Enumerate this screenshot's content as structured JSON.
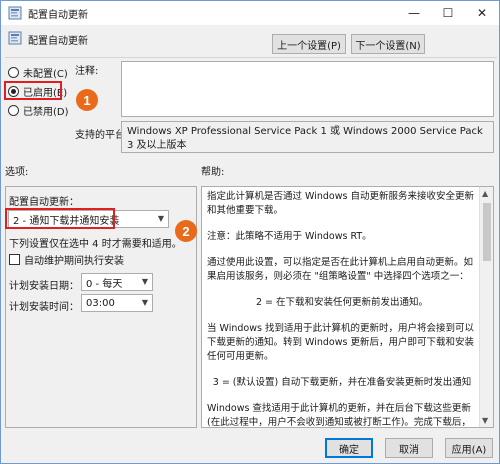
{
  "window": {
    "title": "配置自动更新",
    "minimize": "—",
    "maximize": "☐",
    "close": "✕"
  },
  "header": {
    "title": "配置自动更新",
    "prev_button": "上一个设置(P)",
    "next_button": "下一个设置(N)"
  },
  "state": {
    "options": [
      {
        "label": "未配置(C)",
        "selected": false
      },
      {
        "label": "已启用(E)",
        "selected": true
      },
      {
        "label": "已禁用(D)",
        "selected": false
      }
    ]
  },
  "comment": {
    "label": "注释:",
    "value": ""
  },
  "platform": {
    "label": "支持的平台:",
    "value": "Windows XP Professional Service Pack 1 或 Windows 2000 Service Pack 3 及以上版本"
  },
  "sections": {
    "options_label": "选项:",
    "help_label": "帮助:"
  },
  "options_panel": {
    "title": "配置自动更新：",
    "mode_value": "2 - 通知下载并通知安装",
    "note": "下列设置仅在选中 4 时才需要和适用。",
    "maintenance_checkbox": "自动维护期间执行安装",
    "maintenance_checked": false,
    "schedule_day_label": "计划安装日期：",
    "schedule_day_value": "0 - 每天",
    "schedule_time_label": "计划安装时间：",
    "schedule_time_value": "03:00"
  },
  "help": {
    "paragraphs": [
      "指定此计算机是否通过 Windows 自动更新服务来接收安全更新和其他重要下载。",
      "注意：此策略不适用于 Windows RT。",
      "通过使用此设置，可以指定是否在此计算机上启用自动更新。如果启用该服务，则必须在 \"组策略设置\" 中选择四个选项之一：",
      "2 = 在下载和安装任何更新前发出通知。",
      "当 Windows 找到适用于此计算机的更新时，用户将会接到可以下载更新的通知。转到 Windows 更新后，用户即可下载和安装任何可用更新。",
      "3 = (默认设置) 自动下载更新，并在准备安装更新时发出通知",
      "Windows 查找适用于此计算机的更新，并在后台下载这些更新 (在此过程中，用户不会收到通知或被打断工作)。完成下载后，用户将收到可以安装更新的通知。转到 Windows 更新后，用户即可安装更新。"
    ]
  },
  "footer": {
    "ok": "确定",
    "cancel": "取消",
    "apply": "应用(A)"
  },
  "annotations": {
    "badge1": "1",
    "badge2": "2",
    "color": "#ea6a1b",
    "highlight_color": "#e02020"
  }
}
